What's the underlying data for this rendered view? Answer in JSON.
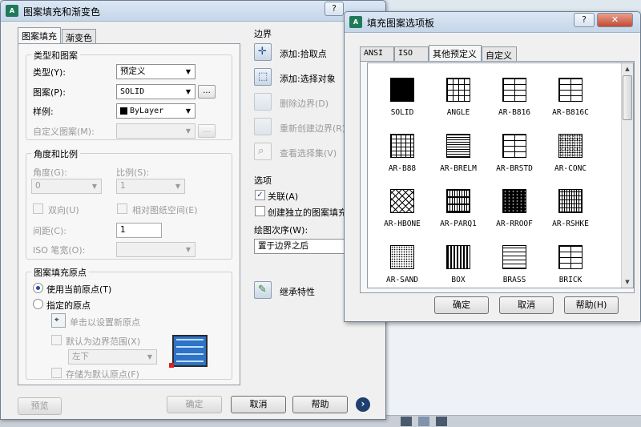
{
  "main_dialog": {
    "title": "图案填充和渐变色",
    "help_btn": "?",
    "close_btn": "✕",
    "tabs": [
      {
        "label": "图案填充"
      },
      {
        "label": "渐变色"
      }
    ],
    "type_group": {
      "title": "类型和图案",
      "type_label": "类型(Y):",
      "type_value": "预定义",
      "pattern_label": "图案(P):",
      "pattern_value": "SOLID",
      "browse": "...",
      "swatch_label": "样例:",
      "swatch_value": "ByLayer",
      "custom_label": "自定义图案(M):",
      "custom_browse": "..."
    },
    "angle_group": {
      "title": "角度和比例",
      "angle_label": "角度(G):",
      "angle_value": "0",
      "scale_label": "比例(S):",
      "scale_value": "1",
      "double_label": "双向(U)",
      "relative_label": "相对图纸空间(E)",
      "spacing_label": "间距(C):",
      "spacing_value": "1",
      "iso_label": "ISO 笔宽(O):"
    },
    "origin_group": {
      "title": "图案填充原点",
      "current_origin": "使用当前原点(T)",
      "specified_origin": "指定的原点",
      "click_set": "单击以设置新原点",
      "default_extent": "默认为边界范围(X)",
      "position_value": "左下",
      "store_default": "存储为默认原点(F)"
    },
    "boundary": {
      "title": "边界",
      "pick_points": "添加:拾取点",
      "select_objects": "添加:选择对象",
      "remove": "删除边界(D)",
      "recreate": "重新创建边界(R)",
      "view": "查看选择集(V)"
    },
    "options": {
      "title": "选项",
      "associative": "关联(A)",
      "independent": "创建独立的图案填充(H)",
      "draw_order_label": "绘图次序(W):",
      "draw_order_value": "置于边界之后"
    },
    "inherit": "继承特性",
    "buttons": {
      "preview": "预览",
      "ok": "确定",
      "cancel": "取消",
      "help": "帮助",
      "more": "›"
    }
  },
  "palette_dialog": {
    "title": "填充图案选项板",
    "help_btn": "?",
    "close_btn": "✕",
    "tabs": [
      {
        "label": "ANSI"
      },
      {
        "label": "ISO"
      },
      {
        "label": "其他预定义"
      },
      {
        "label": "自定义"
      }
    ],
    "patterns": [
      {
        "name": "SOLID",
        "style": "solid"
      },
      {
        "name": "ANGLE",
        "style": "grid"
      },
      {
        "name": "AR-B816",
        "style": "brick"
      },
      {
        "name": "AR-B816C",
        "style": "brick"
      },
      {
        "name": "AR-B88",
        "style": "brick-small"
      },
      {
        "name": "AR-BRELM",
        "style": "lines-dense"
      },
      {
        "name": "AR-BRSTD",
        "style": "brick"
      },
      {
        "name": "AR-CONC",
        "style": "dots"
      },
      {
        "name": "AR-HBONE",
        "style": "herringbone"
      },
      {
        "name": "AR-PARQ1",
        "style": "parquet"
      },
      {
        "name": "AR-RROOF",
        "style": "dark-speckle"
      },
      {
        "name": "AR-RSHKE",
        "style": "shakes"
      },
      {
        "name": "AR-SAND",
        "style": "dots-light"
      },
      {
        "name": "BOX",
        "style": "box"
      },
      {
        "name": "BRASS",
        "style": "h-lines"
      },
      {
        "name": "BRICK",
        "style": "brick"
      }
    ],
    "buttons": {
      "ok": "确定",
      "cancel": "取消",
      "help": "帮助(H)"
    }
  },
  "colors": {
    "title_gradient_top": "#dbe7f4",
    "close_red": "#c24a33",
    "selection_blue": "#1c3f86"
  }
}
